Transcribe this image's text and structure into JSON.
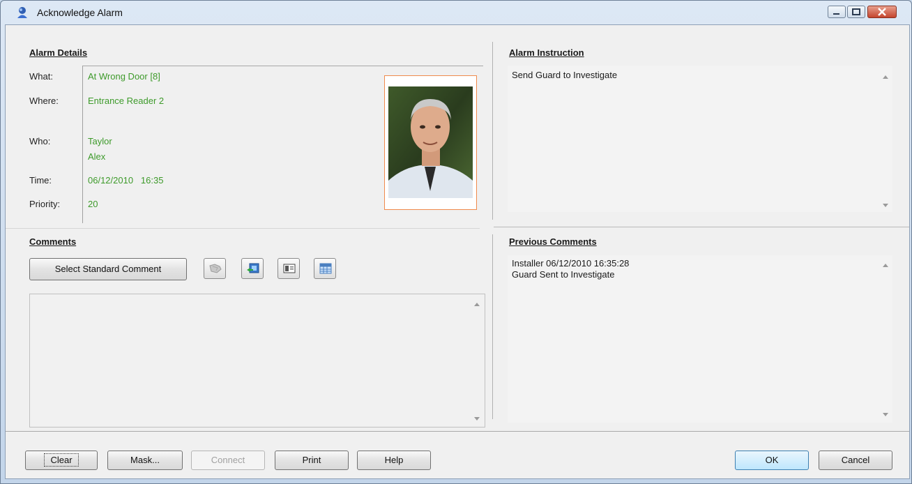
{
  "window": {
    "title": "Acknowledge Alarm",
    "controls": [
      "minimize-icon",
      "maximize-icon",
      "close-icon"
    ]
  },
  "alarm_details": {
    "heading": "Alarm Details",
    "labels": {
      "what": "What:",
      "where": "Where:",
      "who": "Who:",
      "time": "Time:",
      "priority": "Priority:"
    },
    "values": {
      "what": "At Wrong Door [8]",
      "where": "Entrance Reader 2",
      "who_last": "Taylor",
      "who_first": "Alex",
      "time": "06/12/2010   16:35",
      "priority": "20"
    }
  },
  "alarm_instruction": {
    "heading": "Alarm Instruction",
    "text": "Send Guard to Investigate"
  },
  "comments": {
    "heading": "Comments",
    "select_button": "Select Standard Comment",
    "icon_buttons": [
      "speech-icon",
      "image-export-icon",
      "card-icon",
      "grid-icon"
    ],
    "text": ""
  },
  "previous_comments": {
    "heading": "Previous Comments",
    "line1": "Installer 06/12/2010 16:35:28",
    "line2": "Guard Sent to Investigate"
  },
  "buttons": {
    "clear": "Clear",
    "mask": "Mask...",
    "connect": "Connect",
    "print": "Print",
    "help": "Help",
    "ok": "OK",
    "cancel": "Cancel"
  },
  "colors": {
    "value_text": "#3d9a2a",
    "photo_border": "#f08a4b"
  }
}
